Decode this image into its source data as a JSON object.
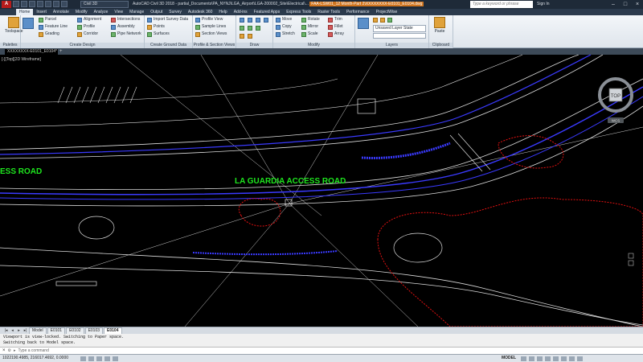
{
  "titlebar": {
    "app_icon": "A",
    "workspace": "Civil 3D",
    "title_prefix": "AutoCAD Civil 3D 2018 - partial_Documents\\PA_NYNJ\\LGA_Airport\\LGA-200002_Site\\Electrical\\...",
    "title_highlight": "FAA-LSW01_12 Month-Part 2\\XXXXXXXX-E0101_E0104.dwg",
    "search_placeholder": "Type a keyword or phrase",
    "signin": "Sign In"
  },
  "tabs": [
    "Home",
    "Insert",
    "Annotate",
    "Modify",
    "Analyze",
    "View",
    "Manage",
    "Output",
    "Survey",
    "Autodesk 360",
    "Help",
    "Add-ins",
    "Featured Apps",
    "Express Tools",
    "Raster Tools",
    "Performance",
    "ProjectWise"
  ],
  "ribbon": {
    "palettes": {
      "toolspace": "Toolspace",
      "title": "Palettes"
    },
    "create_design": {
      "title": "Create Design",
      "items": [
        "Parcel",
        "Feature Line",
        "Grading",
        "Alignment",
        "Profile",
        "Corridor",
        "Intersections",
        "Assembly",
        "Pipe Network"
      ]
    },
    "create_ground": {
      "title": "Create Ground Data",
      "items": [
        "Import Survey Data",
        "Points",
        "Surfaces"
      ]
    },
    "profile_section": {
      "title": "Profile & Section Views",
      "items": [
        "Profile View",
        "Sample Lines",
        "Section Views"
      ]
    },
    "draw": {
      "title": "Draw"
    },
    "modify": {
      "title": "Modify",
      "items": [
        "Move",
        "Copy",
        "Stretch",
        "Rotate",
        "Mirror",
        "Scale",
        "Trim",
        "Fillet",
        "Array"
      ]
    },
    "layers": {
      "title": "Layers",
      "state": "Unsaved Layer State"
    },
    "clipboard": {
      "title": "Clipboard",
      "paste": "Paste"
    }
  },
  "doc_tab": "XXXXXXXX-E0101_E0104*",
  "viewport": {
    "label": "[-][Top][2D Wireframe]",
    "road_label_left": "ESS ROAD",
    "road_label_main": "LA GUARDIA ACCESS ROAD",
    "viewcube_label": "TOP",
    "wcs": "WCS"
  },
  "layout_tabs": [
    "Model",
    "E0101",
    "E0102",
    "E0103",
    "E0104"
  ],
  "active_layout": "E0104",
  "command": {
    "history": [
      "Viewport is view-locked. Switching to Paper space.",
      "Switching back to Model space."
    ],
    "placeholder": "Type a command"
  },
  "status": {
    "coords": "1022190.4985, 216017.4692, 0.0000",
    "model": "MODEL"
  },
  "colors": {
    "road_label": "#1ee61e",
    "road_blue": "#3a3aff",
    "tree_red": "#e01010",
    "linework": "#dcdcdc"
  }
}
